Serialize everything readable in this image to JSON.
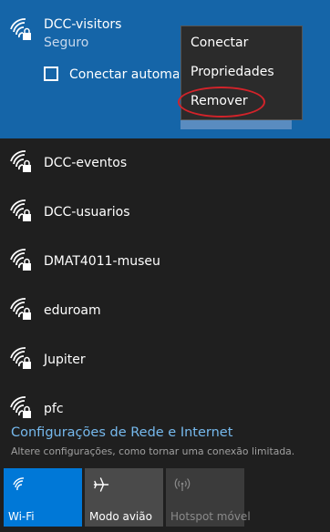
{
  "selected_network": {
    "name": "DCC-visitors",
    "status": "Seguro",
    "auto_connect_label": "Conectar automaticamente",
    "icon": "wifi-secured-icon"
  },
  "context_menu": {
    "items": [
      "Conectar",
      "Propriedades",
      "Remover"
    ]
  },
  "networks": [
    {
      "name": "DCC-eventos",
      "icon": "wifi-secured-icon"
    },
    {
      "name": "DCC-usuarios",
      "icon": "wifi-secured-icon"
    },
    {
      "name": "DMAT4011-museu",
      "icon": "wifi-secured-icon"
    },
    {
      "name": "eduroam",
      "icon": "wifi-secured-icon"
    },
    {
      "name": "Jupiter",
      "icon": "wifi-secured-icon"
    },
    {
      "name": "pfc",
      "icon": "wifi-secured-icon"
    }
  ],
  "settings": {
    "link": "Configurações de Rede e Internet",
    "description": "Altere configurações, como tornar uma conexão limitada."
  },
  "quick_actions": [
    {
      "label": "Wi-Fi",
      "icon": "wifi-icon",
      "state": "on"
    },
    {
      "label": "Modo avião",
      "icon": "airplane-icon",
      "state": "off"
    },
    {
      "label": "Hotspot móvel",
      "icon": "hotspot-icon",
      "state": "disabled"
    }
  ],
  "colors": {
    "background": "#1f1f1f",
    "selected": "#1565a8",
    "accent": "#0078d7",
    "link": "#76b9ed",
    "highlight_ring": "#d2232a"
  }
}
